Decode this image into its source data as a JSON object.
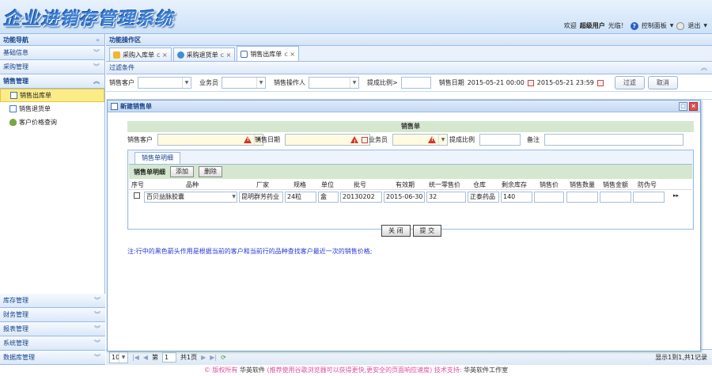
{
  "header": {
    "logo": "企业进销存管理系统",
    "welcome": "欢迎",
    "user": "超级用户",
    "login_suffix": "光临！",
    "control_panel": "控制面板",
    "logout": "退出"
  },
  "nav": {
    "title": "功能导航",
    "top_sections": [
      "基础信息",
      "采购管理"
    ],
    "open_section": "销售管理",
    "open_items": [
      {
        "label": "销售出库单",
        "icon": "doc-icon",
        "selected": true
      },
      {
        "label": "销售退货单",
        "icon": "edit-icon",
        "selected": false
      },
      {
        "label": "客户价格查询",
        "icon": "bug-icon",
        "selected": false
      }
    ],
    "bottom_sections": [
      "库存管理",
      "财务管理",
      "报表管理",
      "系统管理",
      "数据库管理"
    ]
  },
  "main": {
    "title": "功能操作区",
    "tabs": [
      {
        "label": "采购入库单",
        "active": false,
        "color": "#f0b830"
      },
      {
        "label": "采购退货单",
        "active": false,
        "color": "#3d8fd6"
      },
      {
        "label": "销售出库单",
        "active": true,
        "color": "#4a6fa5"
      }
    ],
    "tab_close": "c ×",
    "filter_title": "过滤条件",
    "filter": {
      "customer": "销售客户",
      "salesman": "业务员",
      "operator": "销售操作人",
      "ratio": "提成比例>",
      "date": "销售日期",
      "date_from": "2015-05-21 00:00",
      "date_to": "2015-05-21 23:59",
      "filter_btn": "过滤",
      "cancel_btn": "取消"
    },
    "grid_rownum": "1",
    "pager": {
      "page_size": "10",
      "page_label": "第",
      "page_value": "1",
      "page_total": "共1页",
      "info": "显示1到1,共1记录"
    }
  },
  "dialog": {
    "title": "新建销售单",
    "form_title": "销售单",
    "fields": {
      "customer": "销售客户",
      "date": "销售日期",
      "salesman": "业务员",
      "ratio": "提成比例",
      "remark": "备注"
    },
    "detail_tab": "销售单明细",
    "detail_label": "销售单明细",
    "add_btn": "添加",
    "delete_btn": "删除",
    "columns": [
      "序号",
      "品种",
      "厂家",
      "规格",
      "单位",
      "批号",
      "有效期",
      "统一零售价",
      "仓库",
      "剩余库存",
      "销售价",
      "销售数量",
      "销售金额",
      "防伪号"
    ],
    "row": {
      "product": "百贝益脉胶囊",
      "maker": "昆明群芳药业",
      "spec": "24粒",
      "unit": "盒",
      "batch": "20130202",
      "expiry": "2015-06-30",
      "retail_price": "32",
      "warehouse": "正泰药品",
      "stock": "140",
      "more": "▸▸"
    },
    "close_btn": "关 闭",
    "submit_btn": "提 交",
    "note": "注:行中的黑色箭头作用是根据当前的客户和当前行的品种查找客户最近一次的销售价格;"
  },
  "footer": {
    "copyright": "© 版权所有",
    "company": "华英软件",
    "hint": "(推荐使用谷歌浏览器可以获得更快,更安全的页面响应速度)",
    "support": "技术支持:",
    "studio": "华英软件工作室"
  }
}
